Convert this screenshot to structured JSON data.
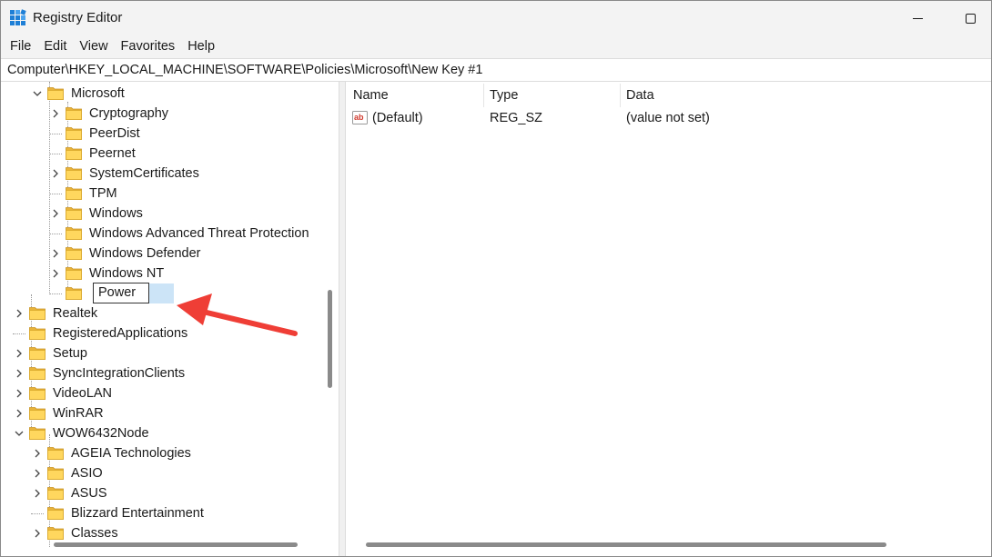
{
  "window": {
    "title": "Registry Editor"
  },
  "menu": [
    "File",
    "Edit",
    "View",
    "Favorites",
    "Help"
  ],
  "address": "Computer\\HKEY_LOCAL_MACHINE\\SOFTWARE\\Policies\\Microsoft\\New Key #1",
  "tree": [
    {
      "label": "Microsoft",
      "level": 1,
      "expander": "expanded"
    },
    {
      "label": "Cryptography",
      "level": 2,
      "expander": "collapsed"
    },
    {
      "label": "PeerDist",
      "level": 2,
      "expander": "none"
    },
    {
      "label": "Peernet",
      "level": 2,
      "expander": "none"
    },
    {
      "label": "SystemCertificates",
      "level": 2,
      "expander": "collapsed"
    },
    {
      "label": "TPM",
      "level": 2,
      "expander": "none"
    },
    {
      "label": "Windows",
      "level": 2,
      "expander": "collapsed"
    },
    {
      "label": "Windows Advanced Threat Protection",
      "level": 2,
      "expander": "none"
    },
    {
      "label": "Windows Defender",
      "level": 2,
      "expander": "collapsed"
    },
    {
      "label": "Windows NT",
      "level": 2,
      "expander": "collapsed"
    },
    {
      "label": "",
      "level": 2,
      "expander": "none",
      "renaming": true
    },
    {
      "label": "Realtek",
      "level": 0,
      "expander": "collapsed"
    },
    {
      "label": "RegisteredApplications",
      "level": 0,
      "expander": "none"
    },
    {
      "label": "Setup",
      "level": 0,
      "expander": "collapsed"
    },
    {
      "label": "SyncIntegrationClients",
      "level": 0,
      "expander": "collapsed"
    },
    {
      "label": "VideoLAN",
      "level": 0,
      "expander": "collapsed"
    },
    {
      "label": "WinRAR",
      "level": 0,
      "expander": "collapsed"
    },
    {
      "label": "WOW6432Node",
      "level": 0,
      "expander": "expanded"
    },
    {
      "label": "AGEIA Technologies",
      "level": 1,
      "expander": "collapsed"
    },
    {
      "label": "ASIO",
      "level": 1,
      "expander": "collapsed"
    },
    {
      "label": "ASUS",
      "level": 1,
      "expander": "collapsed"
    },
    {
      "label": "Blizzard Entertainment",
      "level": 1,
      "expander": "none"
    },
    {
      "label": "Classes",
      "level": 1,
      "expander": "collapsed"
    }
  ],
  "rename": {
    "value": "Power"
  },
  "columns": {
    "name": "Name",
    "type": "Type",
    "data": "Data"
  },
  "values": [
    {
      "name": "(Default)",
      "type": "REG_SZ",
      "data": "(value not set)",
      "icon": "string-value-icon"
    }
  ],
  "annotation": {
    "color": "#ef3e36",
    "icon": "red-arrow-icon"
  }
}
